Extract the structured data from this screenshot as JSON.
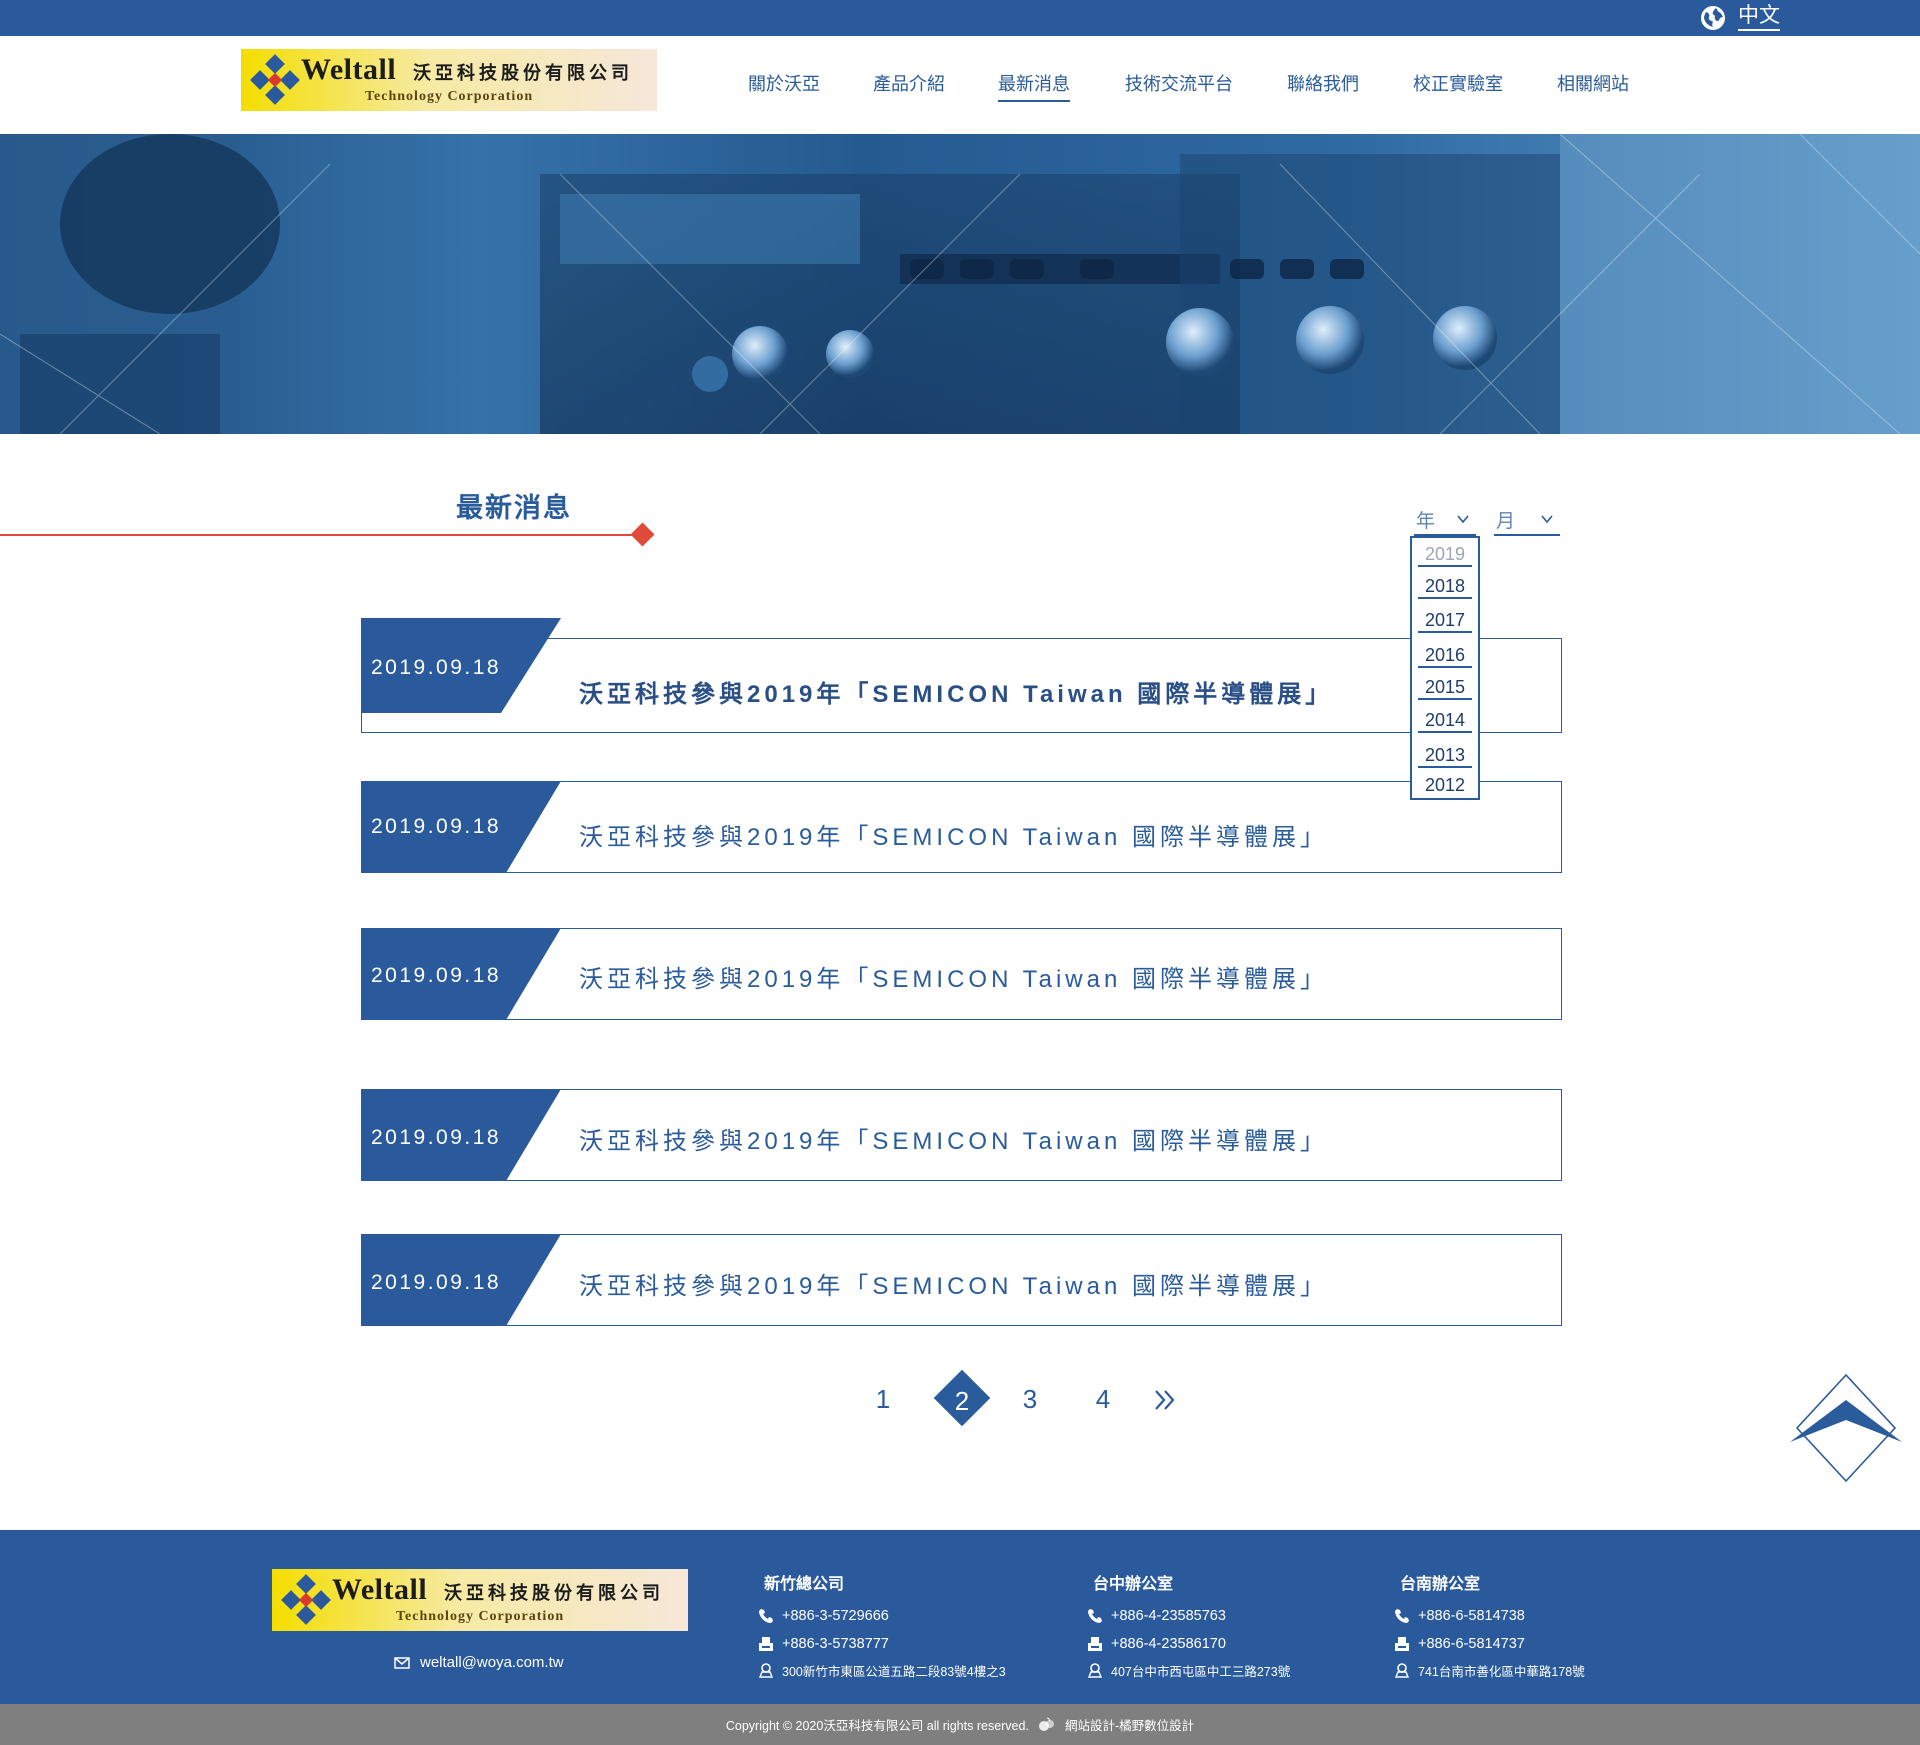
{
  "topbar": {
    "language": "中文"
  },
  "brand": {
    "name_en": "Weltall",
    "name_cn": "沃亞科技股份有限公司",
    "tagline": "Technology Corporation"
  },
  "nav": {
    "items": [
      {
        "label": "關於沃亞"
      },
      {
        "label": "產品介紹"
      },
      {
        "label": "最新消息",
        "active": true
      },
      {
        "label": "技術交流平台"
      },
      {
        "label": "聯絡我們"
      },
      {
        "label": "校正實驗室"
      },
      {
        "label": "相關網站"
      }
    ]
  },
  "section": {
    "title": "最新消息"
  },
  "filters": {
    "year_label": "年",
    "month_label": "月",
    "year_options": [
      "2019",
      "2018",
      "2017",
      "2016",
      "2015",
      "2014",
      "2013",
      "2012"
    ]
  },
  "news": [
    {
      "date": "2019.09.18",
      "title": "沃亞科技參與2019年「SEMICON Taiwan 國際半導體展」"
    },
    {
      "date": "2019.09.18",
      "title": "沃亞科技參與2019年「SEMICON Taiwan 國際半導體展」"
    },
    {
      "date": "2019.09.18",
      "title": "沃亞科技參與2019年「SEMICON Taiwan 國際半導體展」"
    },
    {
      "date": "2019.09.18",
      "title": "沃亞科技參與2019年「SEMICON Taiwan 國際半導體展」"
    },
    {
      "date": "2019.09.18",
      "title": "沃亞科技參與2019年「SEMICON Taiwan 國際半導體展」"
    }
  ],
  "pagination": {
    "pages": [
      "1",
      "2",
      "3",
      "4"
    ],
    "current": "2",
    "next_icon": "double-chevron-right-icon"
  },
  "footer": {
    "email": "weltall@woya.com.tw",
    "offices": [
      {
        "name": "新竹總公司",
        "phone": "+886-3-5729666",
        "fax": "+886-3-5738777",
        "address": "300新竹市東區公道五路二段83號4樓之3"
      },
      {
        "name": "台中辦公室",
        "phone": "+886-4-23585763",
        "fax": "+886-4-23586170",
        "address": "407台中市西屯區中工三路273號"
      },
      {
        "name": "台南辦公室",
        "phone": "+886-6-5814738",
        "fax": "+886-6-5814737",
        "address": "741台南市善化區中華路178號"
      }
    ],
    "copyright": "Copyright © 2020沃亞科技有限公司 all rights reserved.",
    "designer": "網站設計-橘野數位設計"
  },
  "colors": {
    "primary": "#2a5a9c",
    "accent": "#e04a3a",
    "footer_bottom": "#7f7f7f",
    "logo_yellow": "#f4de00"
  }
}
